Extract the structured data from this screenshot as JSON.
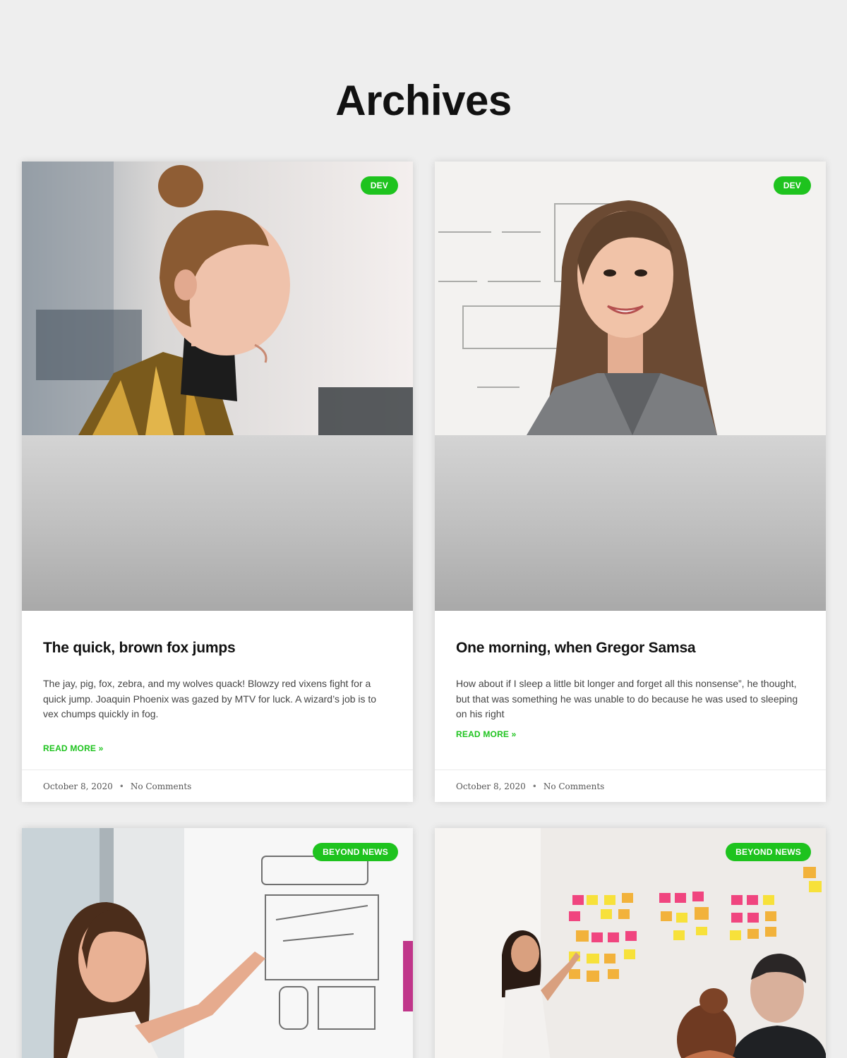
{
  "page": {
    "title": "Archives"
  },
  "colors": {
    "accent": "#1ec31e",
    "background": "#eeeeee",
    "card": "#ffffff"
  },
  "posts": [
    {
      "badge": "DEV",
      "title": "The quick, brown fox jumps",
      "excerpt": "The jay, pig, fox, zebra, and my wolves quack! Blowzy red vixens fight for a quick jump. Joaquin Phoenix was gazed by MTV for luck. A wizard’s job is to vex chumps quickly in fog.",
      "read_more": "READ MORE »",
      "date": "October 8, 2020",
      "separator": "•",
      "comments": "No Comments",
      "image": "woman-in-profile-photo"
    },
    {
      "badge": "DEV",
      "title": "One morning, when Gregor Samsa",
      "excerpt": "How about if I sleep a little bit longer and forget all this nonsense”, he thought, but that was something he was unable to do because he was used to sleeping on his right",
      "read_more": "READ MORE »",
      "date": "October 8, 2020",
      "separator": "•",
      "comments": "No Comments",
      "image": "woman-at-whiteboard-photo"
    },
    {
      "badge": "BEYOND NEWS",
      "image": "woman-pointing-at-wireframe-photo"
    },
    {
      "badge": "BEYOND NEWS",
      "image": "sticky-notes-meeting-photo"
    }
  ]
}
